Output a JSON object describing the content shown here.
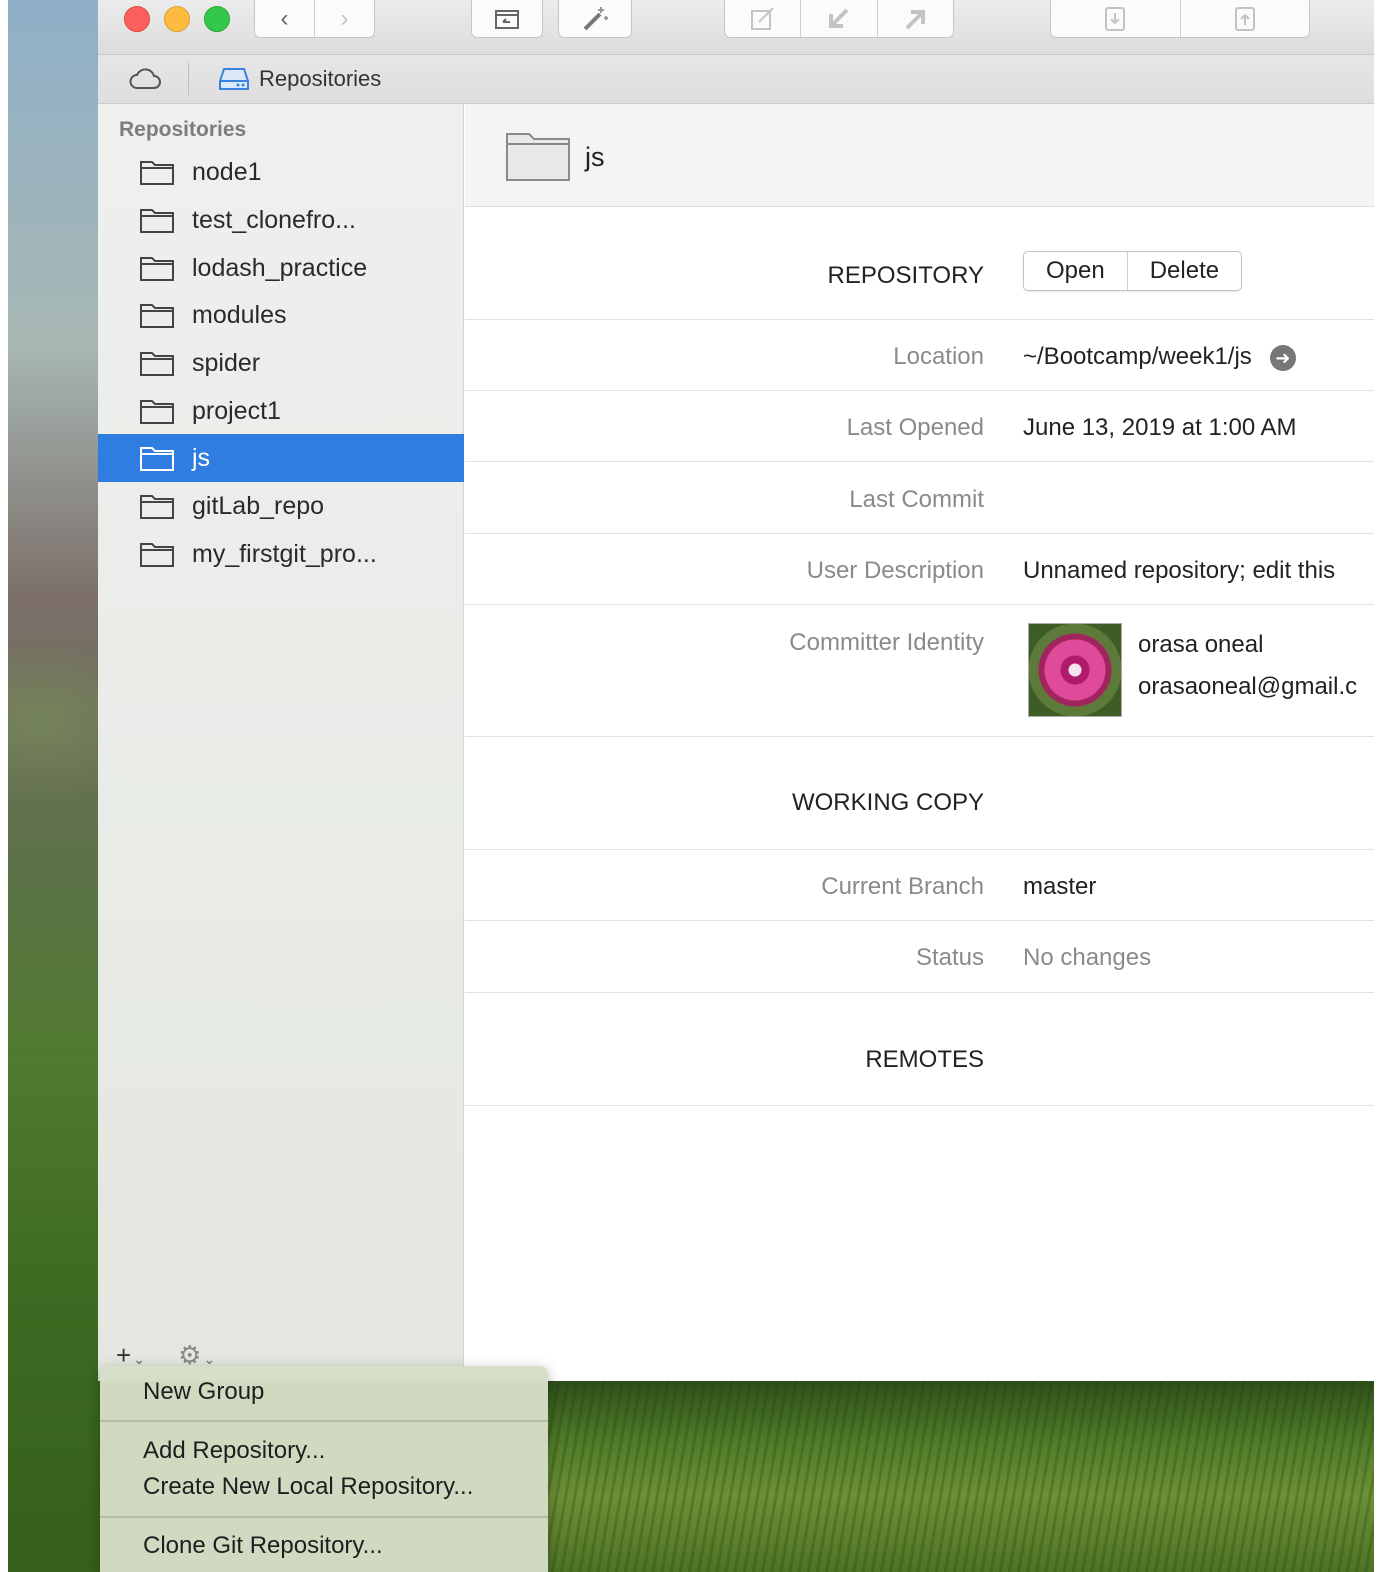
{
  "breadcrumb": {
    "label": "Repositories"
  },
  "sidebar": {
    "header": "Repositories",
    "items": [
      {
        "label": "node1"
      },
      {
        "label": "test_clonefro..."
      },
      {
        "label": "lodash_practice"
      },
      {
        "label": "modules"
      },
      {
        "label": "spider"
      },
      {
        "label": "project1"
      },
      {
        "label": "js"
      },
      {
        "label": "gitLab_repo"
      },
      {
        "label": "my_firstgit_pro..."
      }
    ],
    "selected_index": 6,
    "add_glyph": "+",
    "gear_glyph": "⚙",
    "chevron_glyph": "⌄"
  },
  "main": {
    "title": "js",
    "repository": {
      "section": "REPOSITORY",
      "open_label": "Open",
      "delete_label": "Delete",
      "location_label": "Location",
      "location_value": "~/Bootcamp/week1/js",
      "last_opened_label": "Last Opened",
      "last_opened_value": "June 13, 2019 at 1:00 AM",
      "last_commit_label": "Last Commit",
      "user_description_label": "User Description",
      "user_description_value": "Unnamed repository; edit this",
      "committer_identity_label": "Committer Identity",
      "committer_name": "orasa oneal",
      "committer_email": "orasaoneal@gmail.c"
    },
    "working_copy": {
      "section": "WORKING COPY",
      "current_branch_label": "Current Branch",
      "current_branch_value": "master",
      "status_label": "Status",
      "status_value": "No changes"
    },
    "remotes": {
      "section": "REMOTES"
    }
  },
  "menu": {
    "items": [
      {
        "label": "New Group"
      },
      {
        "label": "Add Repository..."
      },
      {
        "label": "Create New Local Repository..."
      },
      {
        "label": "Clone Git Repository..."
      }
    ]
  },
  "colors": {
    "selection": "#2f7de1",
    "close": "#fc605c",
    "minimize": "#fdbc40",
    "zoom": "#34c84a"
  }
}
